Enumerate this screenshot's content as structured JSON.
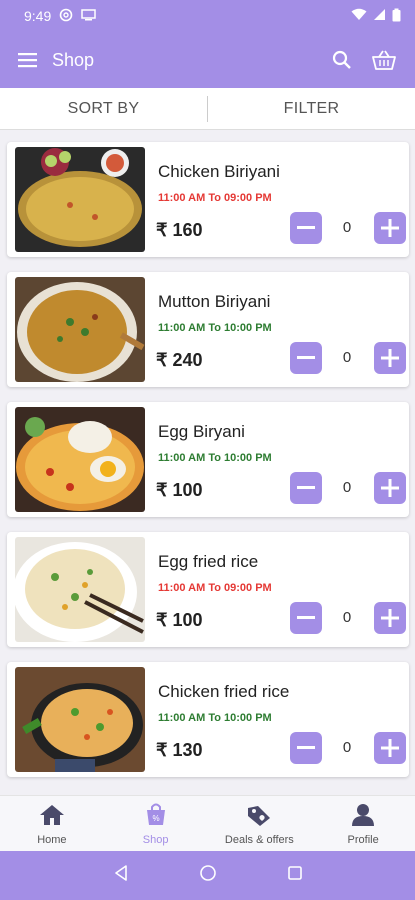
{
  "status_bar": {
    "time": "9:49"
  },
  "app_bar": {
    "title": "Shop"
  },
  "sort_filter": {
    "sort_label": "SORT BY",
    "filter_label": "FILTER"
  },
  "products": [
    {
      "name": "Chicken Biriyani",
      "timing": "11:00 AM To 09:00 PM",
      "timing_color": "#e53935",
      "price": "₹ 160",
      "quantity": "0"
    },
    {
      "name": "Mutton Biriyani",
      "timing": "11:00 AM To 10:00 PM",
      "timing_color": "#2e7d32",
      "price": "₹ 240",
      "quantity": "0"
    },
    {
      "name": "Egg Biryani",
      "timing": "11:00 AM To 10:00 PM",
      "timing_color": "#2e7d32",
      "price": "₹ 100",
      "quantity": "0"
    },
    {
      "name": "Egg fried rice",
      "timing": "11:00 AM To 09:00 PM",
      "timing_color": "#e53935",
      "price": "₹ 100",
      "quantity": "0"
    },
    {
      "name": "Chicken fried rice",
      "timing": "11:00 AM To 10:00 PM",
      "timing_color": "#2e7d32",
      "price": "₹ 130",
      "quantity": "0"
    }
  ],
  "bottom_nav": {
    "items": [
      {
        "label": "Home",
        "icon": "home-icon"
      },
      {
        "label": "Shop",
        "icon": "shop-bag-icon"
      },
      {
        "label": "Deals & offers",
        "icon": "deals-tag-icon"
      },
      {
        "label": "Profile",
        "icon": "profile-icon"
      }
    ],
    "active": "Shop"
  },
  "colors": {
    "primary": "#a38ee6",
    "red_timing": "#e53935",
    "green_timing": "#2e7d32"
  }
}
